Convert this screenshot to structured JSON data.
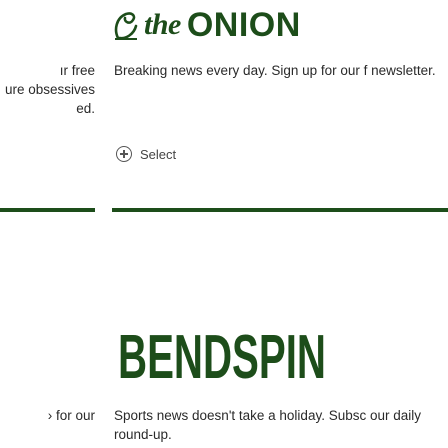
{
  "left_panel": {
    "text_block_1": [
      "ır free",
      "ure obsessives",
      "ed."
    ],
    "text_block_2": "› for our"
  },
  "onion": {
    "logo_the": "the",
    "logo_onion": "ONION",
    "description": "Breaking news every day. Sign up for our f newsletter.",
    "select_label": "Select"
  },
  "benders": {
    "logo_text": "BENDSPIN",
    "description": "Sports news doesn't take a holiday. Subsc our daily round-up."
  },
  "colors": {
    "brand_green": "#1d4d1a",
    "text": "#2a2a2a"
  }
}
